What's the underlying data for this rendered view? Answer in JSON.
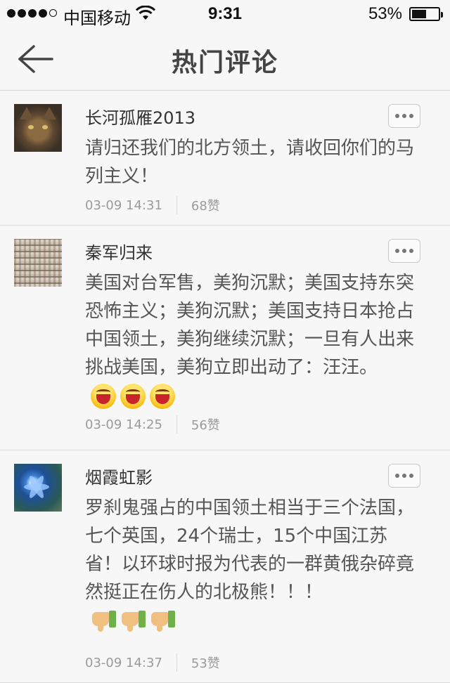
{
  "status_bar": {
    "carrier": "中国移动",
    "time": "9:31",
    "battery_percent": "53%",
    "battery_level": 0.53,
    "signal_bars": 4
  },
  "nav": {
    "title": "热门评论",
    "back_icon": "arrow-left-icon"
  },
  "comments": [
    {
      "username": "长河孤雁2013",
      "content": "请归还我们的北方领土，请收回你们的马列主义！",
      "emojis": [],
      "time": "03-09 14:31",
      "likes": "68赞"
    },
    {
      "username": "秦军归来",
      "content": "美国对台军售，美狗沉默；美国支持东突恐怖主义；美狗沉默；美国支持日本抢占中国领土，美狗继续沉默；一旦有人出来挑战美国，美狗立即出动了：汪汪。",
      "emojis": [
        "laugh-emoji",
        "laugh-emoji",
        "laugh-emoji"
      ],
      "time": "03-09 14:25",
      "likes": "56赞"
    },
    {
      "username": "烟霞虹影",
      "content": "罗刹鬼强占的中国领土相当于三个法国，七个英国，24个瑞士，15个中国江苏省！以环球时报为代表的一群黄俄杂碎竟然挺正在伤人的北极熊！！！",
      "emojis": [
        "thumbs-down-emoji",
        "thumbs-down-emoji",
        "thumbs-down-emoji"
      ],
      "time": "03-09 14:37",
      "likes": "53赞"
    }
  ]
}
